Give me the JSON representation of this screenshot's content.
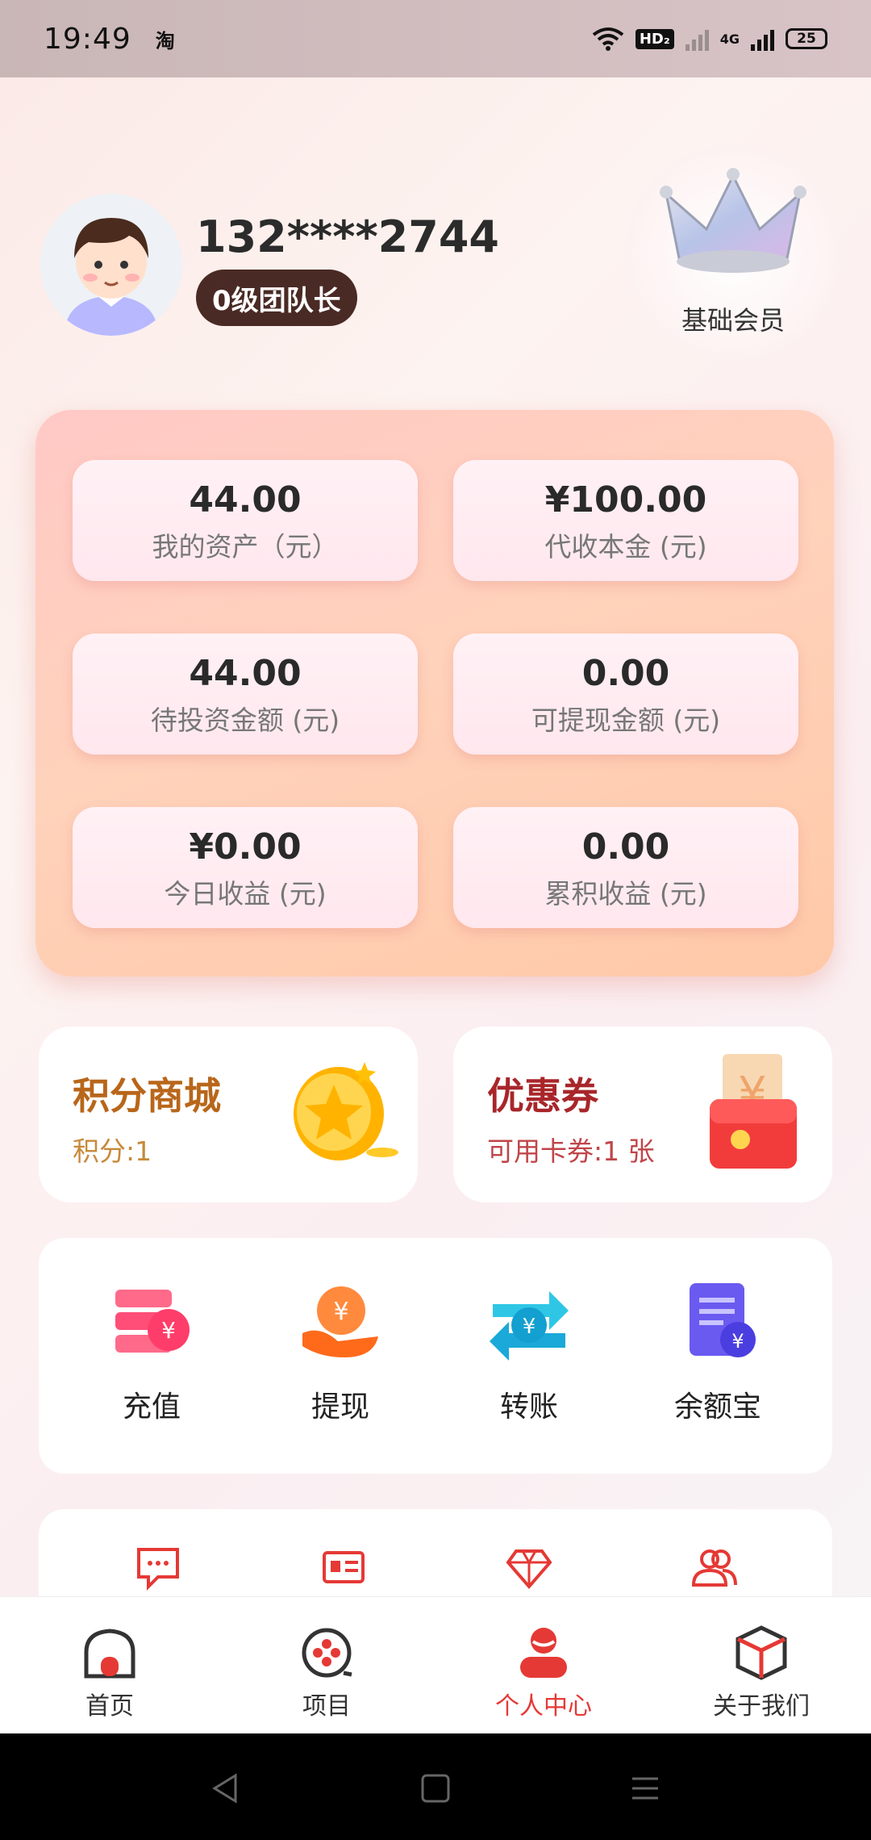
{
  "status_bar": {
    "time": "19:49",
    "app_icon": "淘",
    "hd": "HD₂",
    "network": "4G",
    "battery": "25"
  },
  "profile": {
    "phone": "132****2744",
    "level": "0级团队长",
    "membership": "基础会员"
  },
  "assets": [
    {
      "value": "44.00",
      "label": "我的资产（元）"
    },
    {
      "value": "¥100.00",
      "label": "代收本金 (元)"
    },
    {
      "value": "44.00",
      "label": "待投资金额 (元)"
    },
    {
      "value": "0.00",
      "label": "可提现金额 (元)"
    },
    {
      "value": "¥0.00",
      "label": "今日收益 (元)"
    },
    {
      "value": "0.00",
      "label": "累积收益 (元)"
    }
  ],
  "points_mall": {
    "title": "积分商城",
    "subtitle": "积分:1",
    "color": "#b8661a"
  },
  "coupons": {
    "title": "优惠券",
    "subtitle": "可用卡券:1 张",
    "color": "#a8262a"
  },
  "actions": [
    {
      "label": "充值",
      "icon": "recharge-icon"
    },
    {
      "label": "提现",
      "icon": "withdraw-icon"
    },
    {
      "label": "转账",
      "icon": "transfer-icon"
    },
    {
      "label": "余额宝",
      "icon": "balance-treasure-icon"
    }
  ],
  "more_icons": [
    "message-icon",
    "id-card-icon",
    "diamond-icon",
    "team-icon"
  ],
  "tabs": [
    {
      "label": "首页",
      "icon": "home-icon",
      "active": false
    },
    {
      "label": "项目",
      "icon": "project-icon",
      "active": false
    },
    {
      "label": "个人中心",
      "icon": "profile-icon",
      "active": true
    },
    {
      "label": "关于我们",
      "icon": "about-icon",
      "active": false
    }
  ],
  "colors": {
    "accent": "#e53935",
    "level_badge": "#4a2a24"
  }
}
